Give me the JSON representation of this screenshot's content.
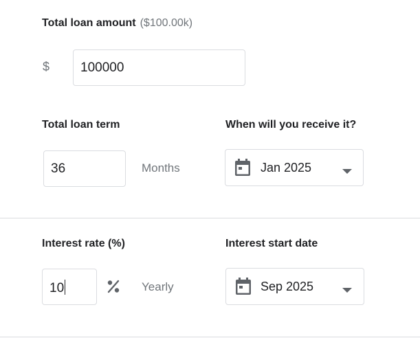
{
  "loan_amount": {
    "label": "Total loan amount",
    "summary": "($100.00k)",
    "currency_symbol": "$",
    "value": "100000"
  },
  "loan_term": {
    "label": "Total loan term",
    "value": "36",
    "unit": "Months"
  },
  "receive_date": {
    "label": "When will you receive it?",
    "value": "Jan 2025",
    "icon": "calendar-icon"
  },
  "interest_rate": {
    "label": "Interest rate (%)",
    "value": "10",
    "unit_icon": "percent-icon",
    "period": "Yearly"
  },
  "interest_start": {
    "label": "Interest start date",
    "value": "Sep 2025",
    "icon": "calendar-icon"
  },
  "colors": {
    "border": "#dadce0",
    "text": "#202124",
    "muted": "#70757a",
    "icon": "#5f6368"
  }
}
